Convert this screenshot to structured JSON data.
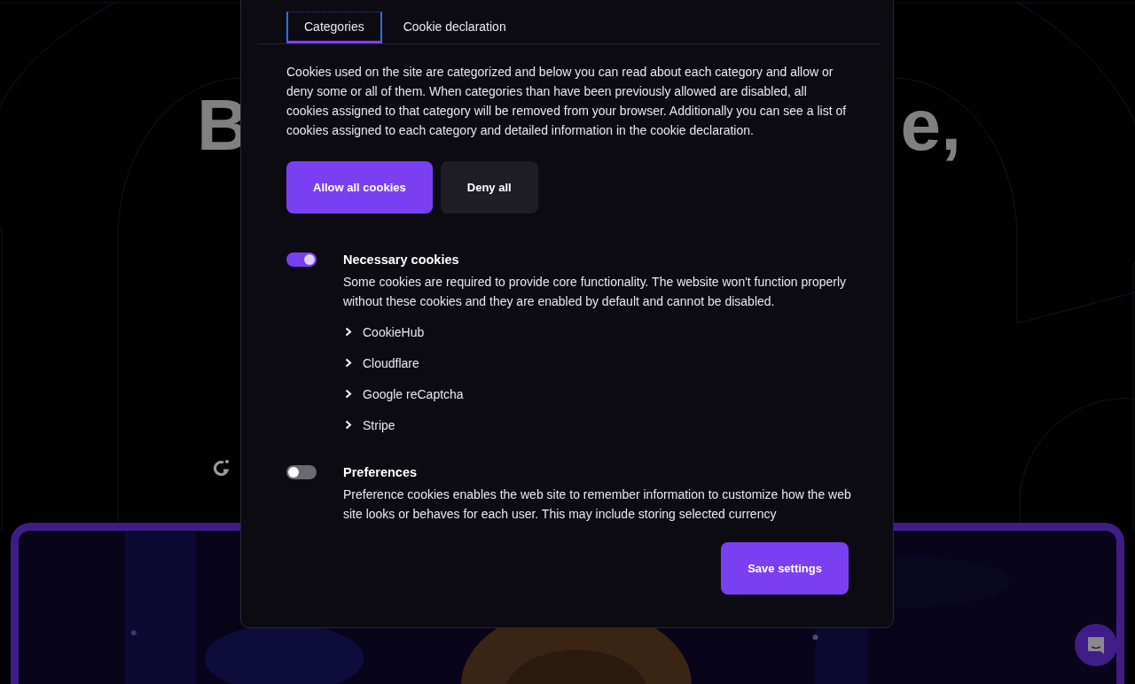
{
  "hero": {
    "headline_fragments": [
      "B",
      "e,"
    ]
  },
  "cookie_dialog": {
    "tabs": [
      {
        "label": "Categories",
        "selected": true
      },
      {
        "label": "Cookie declaration",
        "selected": false
      }
    ],
    "intro": "Cookies used on the site are categorized and below you can read about each category and allow or deny some or all of them. When categories than have been previously allowed are disabled, all cookies assigned to that category will be removed from your browser. Additionally you can see a list of cookies assigned to each category and detailed information in the cookie declaration.",
    "allow_all_button": "Allow all cookies",
    "deny_all_button": "Deny all",
    "categories": [
      {
        "title": "Necessary cookies",
        "on": true,
        "description": "Some cookies are required to provide core functionality. The website won't function properly without these cookies and they are enabled by default and cannot be disabled.",
        "vendors": [
          {
            "name": "CookieHub",
            "expanded": false
          },
          {
            "name": "Cloudflare",
            "expanded": false
          },
          {
            "name": "Google reCaptcha",
            "expanded": false
          },
          {
            "name": "Stripe",
            "expanded": false
          }
        ]
      },
      {
        "title": "Preferences",
        "on": false,
        "description": "Preference cookies enables the web site to remember information to customize how the web site looks or behaves for each user. This may include storing selected currency"
      }
    ],
    "save_button": "Save settings"
  }
}
